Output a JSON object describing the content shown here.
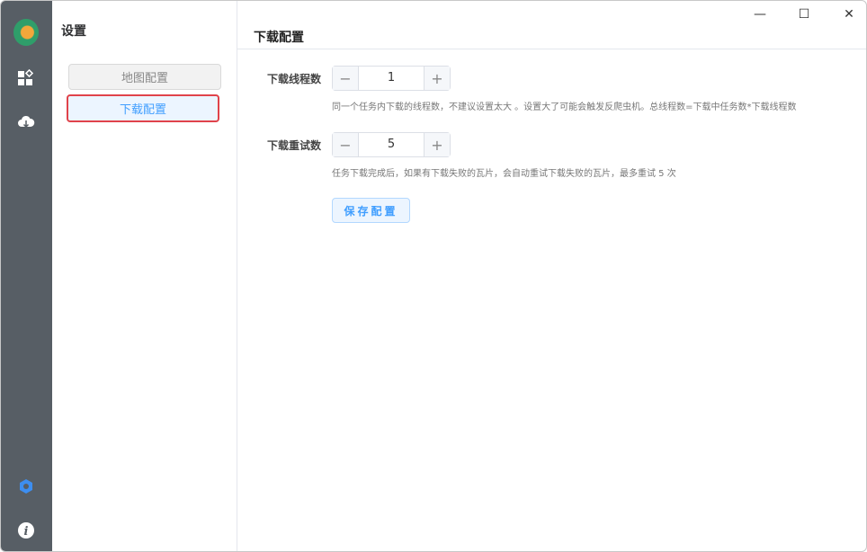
{
  "sidebar": {
    "title": "设置",
    "items": [
      {
        "label": "地图配置"
      },
      {
        "label": "下载配置"
      }
    ]
  },
  "header": {
    "title": "下载配置"
  },
  "window_controls": {
    "minimize": "—",
    "maximize": "☐",
    "close": "✕"
  },
  "form": {
    "threads": {
      "label": "下载线程数",
      "value": "1",
      "minus": "−",
      "plus": "+",
      "hint": "同一个任务内下载的线程数，不建议设置太大 。设置大了可能会触发反爬虫机。总线程数=下载中任务数*下载线程数"
    },
    "retries": {
      "label": "下载重试数",
      "value": "5",
      "minus": "−",
      "plus": "+",
      "hint": "任务下载完成后，如果有下载失败的瓦片，会自动重试下载失败的瓦片，最多重试 5 次"
    },
    "save_label": "保存配置"
  },
  "colors": {
    "accent": "#409eff",
    "rail": "#575e65",
    "highlight": "#e0434b"
  }
}
